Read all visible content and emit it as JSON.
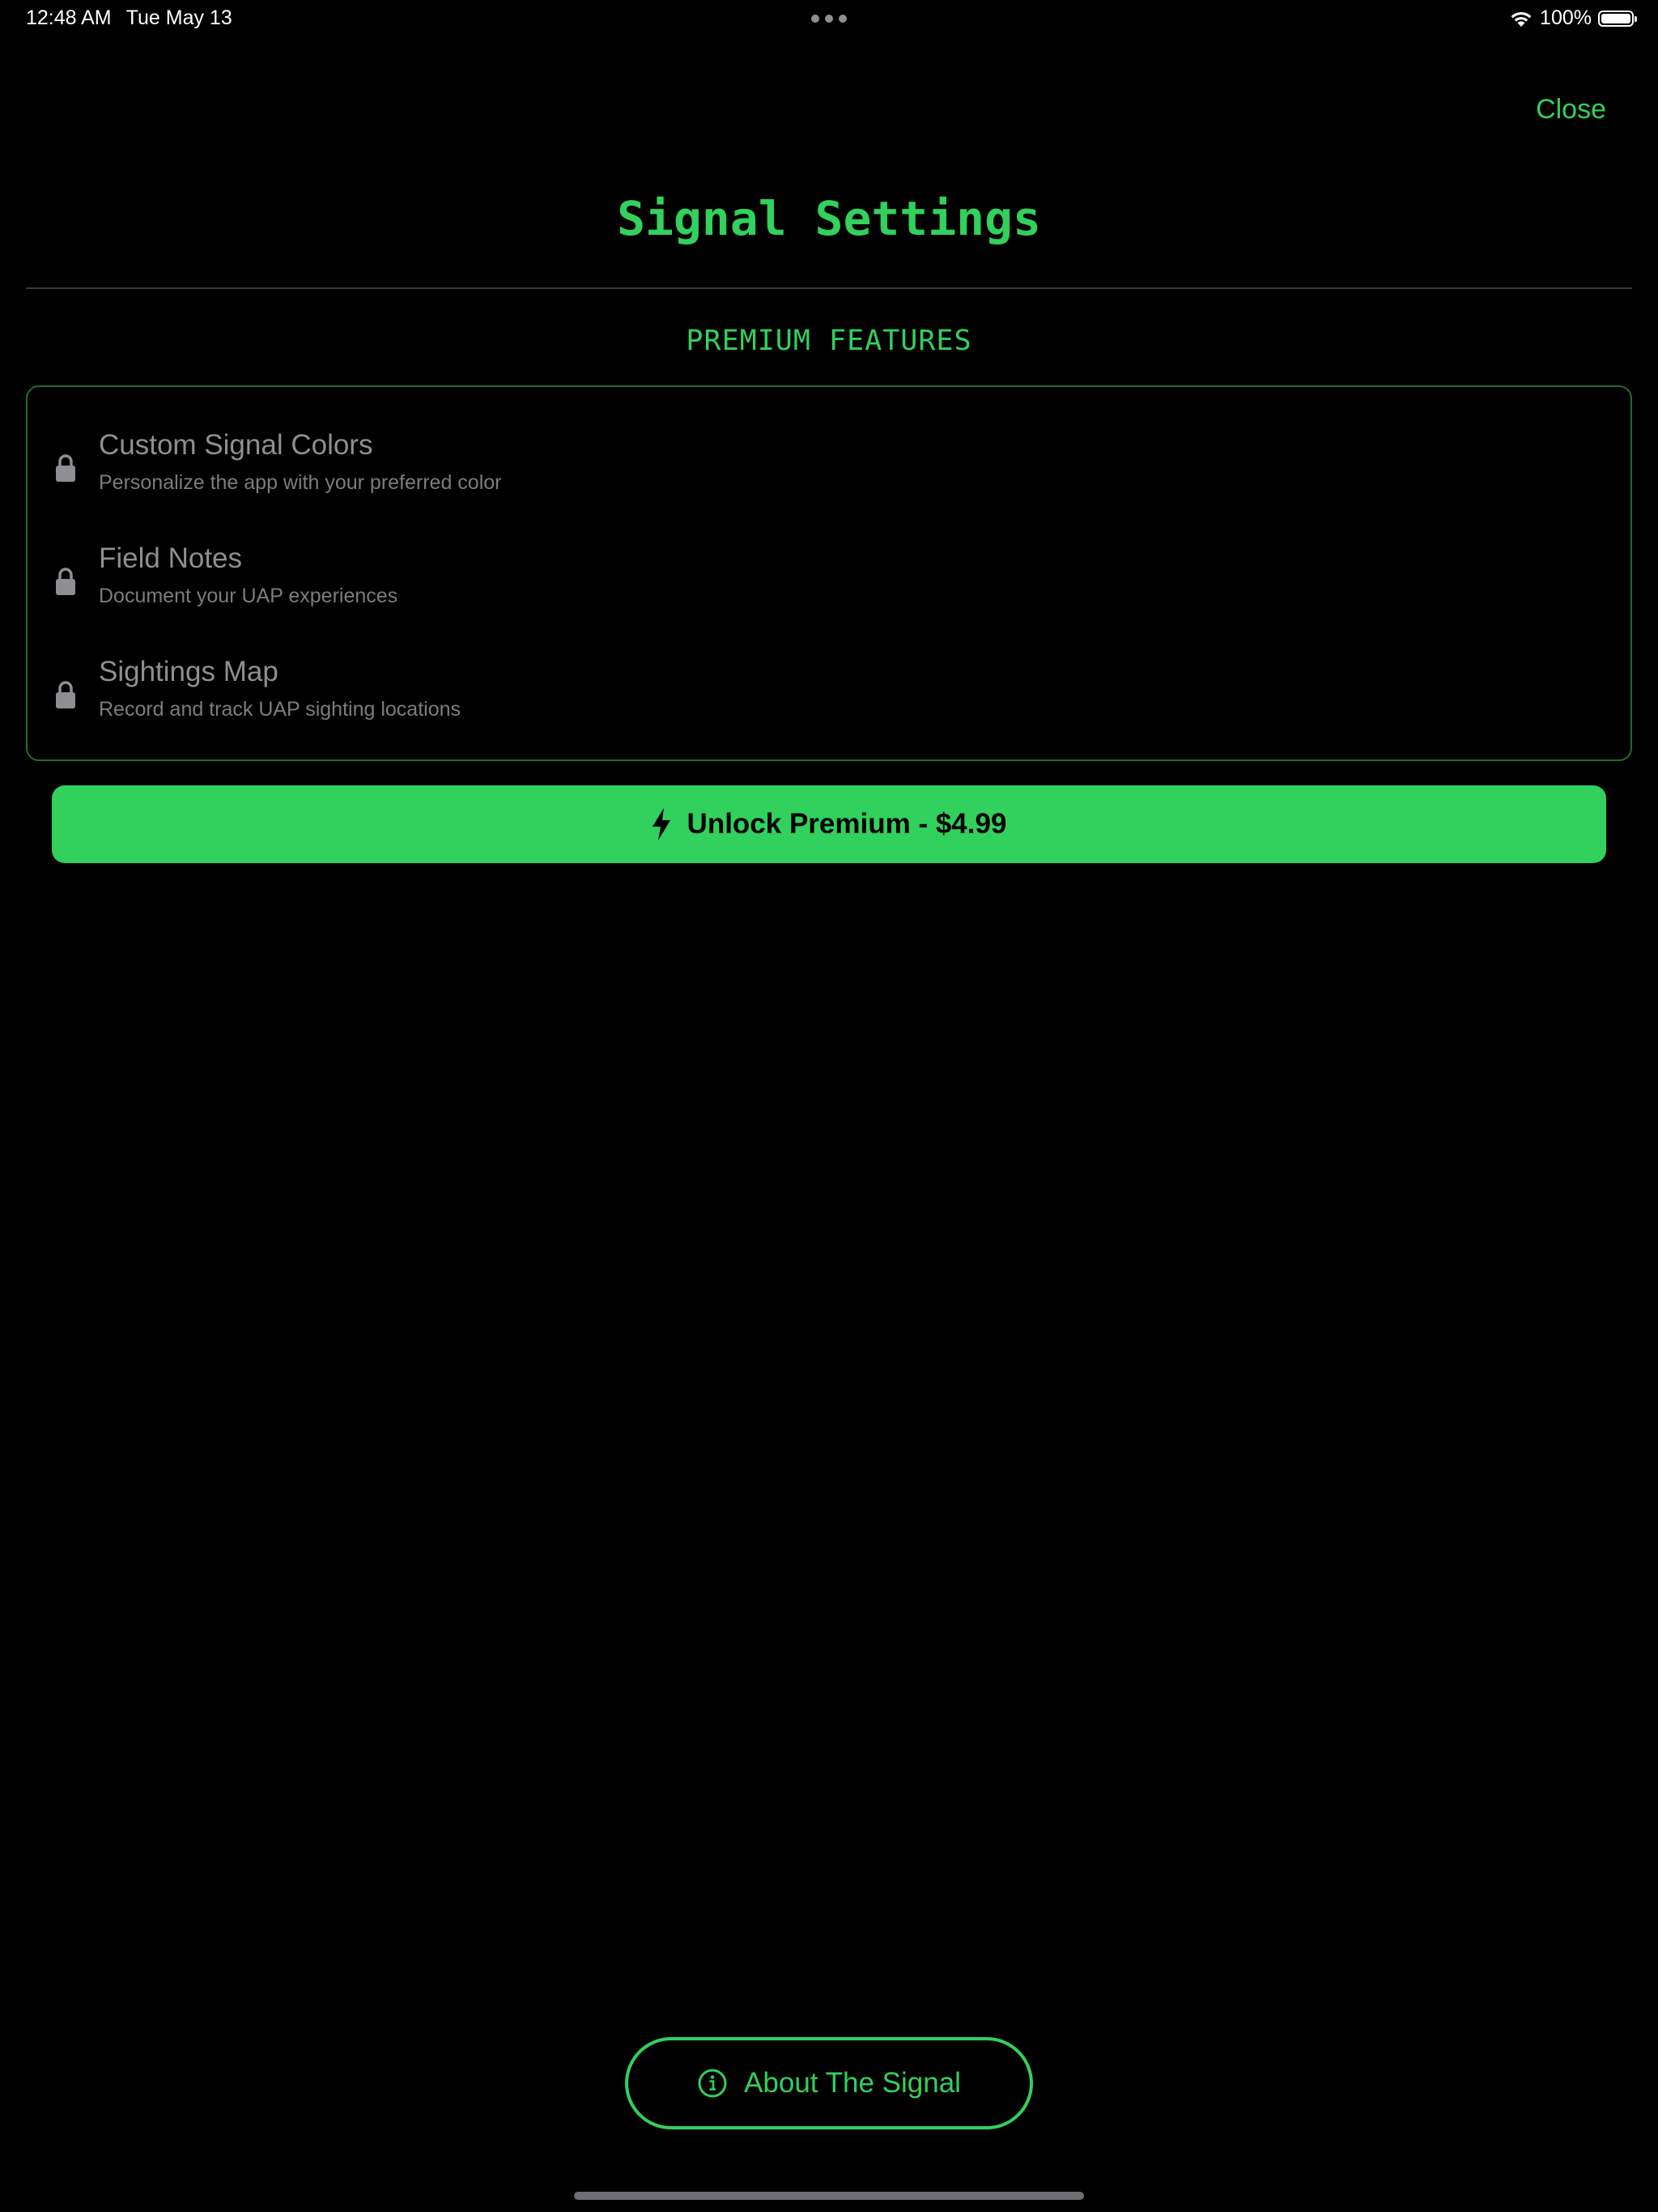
{
  "status_bar": {
    "time": "12:48 AM",
    "date": "Tue May 13",
    "battery": "100%",
    "wifi_icon": "wifi-icon",
    "battery_icon": "battery-icon"
  },
  "header": {
    "close_label": "Close",
    "title": "Signal Settings"
  },
  "premium": {
    "section_title": "PREMIUM FEATURES",
    "features": [
      {
        "title": "Custom Signal Colors",
        "description": "Personalize the app with your preferred color",
        "icon": "lock-icon"
      },
      {
        "title": "Field Notes",
        "description": "Document your UAP experiences",
        "icon": "lock-icon"
      },
      {
        "title": "Sightings Map",
        "description": "Record and track UAP sighting locations",
        "icon": "lock-icon"
      }
    ],
    "unlock_label": "Unlock Premium - $4.99",
    "unlock_icon": "bolt-icon"
  },
  "footer": {
    "about_label": "About The Signal",
    "about_icon": "info-icon"
  },
  "colors": {
    "accent": "#32d05c",
    "background": "#000000",
    "muted_text": "#8e8e93",
    "card_border": "#1f6b32"
  }
}
